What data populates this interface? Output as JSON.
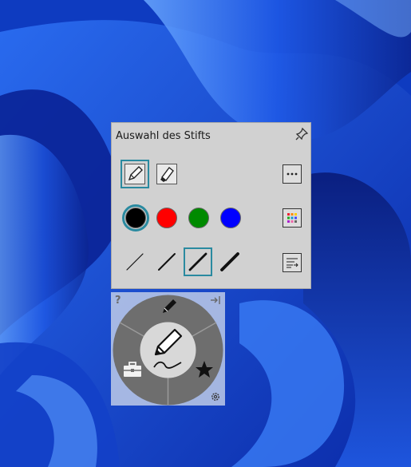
{
  "panel": {
    "title": "Auswahl des Stifts",
    "tools": [
      {
        "icon": "pencil-icon",
        "selected": true
      },
      {
        "icon": "highlighter-icon",
        "selected": false
      }
    ],
    "more_icon": "more-options-icon",
    "colors": [
      {
        "name": "black",
        "hex": "#000000",
        "selected": true
      },
      {
        "name": "red",
        "hex": "#ff0000",
        "selected": false
      },
      {
        "name": "green",
        "hex": "#008a00",
        "selected": false
      },
      {
        "name": "blue",
        "hex": "#0000ff",
        "selected": false
      }
    ],
    "palette_icon": "color-palette-icon",
    "widths": [
      {
        "level": 1,
        "selected": false
      },
      {
        "level": 2,
        "selected": false
      },
      {
        "level": 3,
        "selected": true
      },
      {
        "level": 4,
        "selected": false
      }
    ],
    "width_settings_icon": "line-width-settings-icon",
    "accent": "#2a8aa0"
  },
  "wheel": {
    "help_label": "?",
    "center_icon": "pen-ink-icon",
    "items": [
      "pen-icon",
      "toolbox-icon",
      "star-icon",
      "settings-icon",
      "collapse-icon"
    ]
  }
}
